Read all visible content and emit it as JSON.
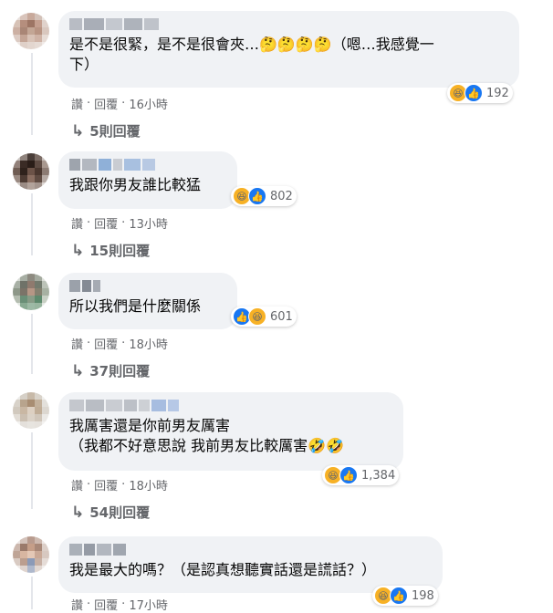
{
  "comments": [
    {
      "text": "是不是很緊，是不是很會夾…🤔🤔🤔🤔（嗯…我感覺一\n下）",
      "reaction_count": "192",
      "like_label": "讚",
      "reply_label": "回覆",
      "time": "16小時",
      "replies": "5則回覆",
      "reactions": [
        "haha-icon",
        "like-icon"
      ]
    },
    {
      "text": "我跟你男友誰比較猛",
      "reaction_count": "802",
      "like_label": "讚",
      "reply_label": "回覆",
      "time": "13小時",
      "replies": "15則回覆",
      "reactions": [
        "haha-icon",
        "like-icon"
      ]
    },
    {
      "text": "所以我們是什麼關係",
      "reaction_count": "601",
      "like_label": "讚",
      "reply_label": "回覆",
      "time": "18小時",
      "replies": "37則回覆",
      "reactions": [
        "like-icon",
        "haha-icon"
      ]
    },
    {
      "text": "我厲害還是你前男友厲害\n（我都不好意思說 我前男友比較厲害🤣🤣",
      "reaction_count": "1,384",
      "like_label": "讚",
      "reply_label": "回覆",
      "time": "18小時",
      "replies": "54則回覆",
      "reactions": [
        "haha-icon",
        "like-icon"
      ]
    },
    {
      "text": "我是最大的嗎？（是認真想聽實話還是謊話？）",
      "reaction_count": "198",
      "like_label": "讚",
      "reply_label": "回覆",
      "time": "17小時",
      "replies": "",
      "reactions": [
        "haha-icon",
        "like-icon"
      ]
    }
  ],
  "separator": "·",
  "reply_arrow": "↳",
  "colors": {
    "bubble": "#f0f2f5",
    "meta_text": "#65676b",
    "like_blue": "#1877f2",
    "haha_yellow": "#f7b125"
  }
}
